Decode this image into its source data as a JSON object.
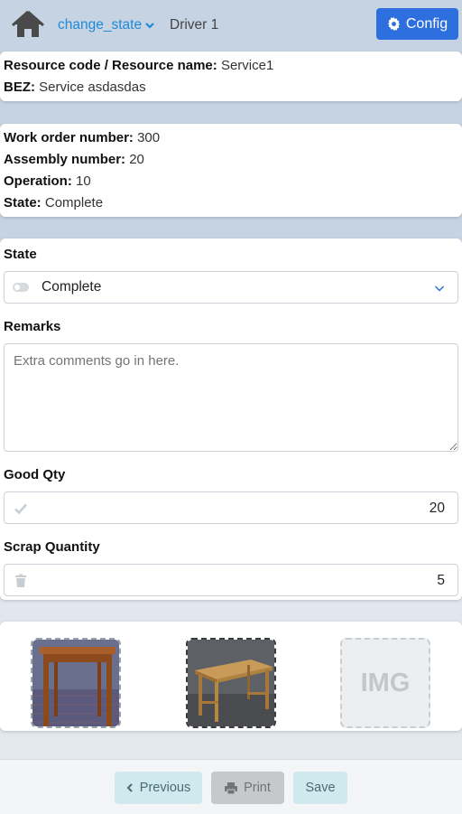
{
  "header": {
    "state_link": "change_state",
    "driver": "Driver 1",
    "config_label": "Config"
  },
  "resource": {
    "code_label": "Resource code / Resource name:",
    "code_value": "Service1",
    "bez_label": "BEZ:",
    "bez_value": "Service asdasdas"
  },
  "order": {
    "work_order_label": "Work order number:",
    "work_order_value": "300",
    "assembly_label": "Assembly number:",
    "assembly_value": "20",
    "operation_label": "Operation:",
    "operation_value": "10",
    "state_label": "State:",
    "state_value": "Complete"
  },
  "form": {
    "state_label": "State",
    "state_selected": "Complete",
    "remarks_label": "Remarks",
    "remarks_placeholder": "Extra comments go in here.",
    "good_qty_label": "Good Qty",
    "good_qty_value": "20",
    "scrap_label": "Scrap Quantity",
    "scrap_value": "5"
  },
  "images": {
    "placeholder_text": "IMG"
  },
  "footer": {
    "previous_label": "Previous",
    "print_label": "Print",
    "save_label": "Save"
  },
  "colors": {
    "accent": "#2e6fe0",
    "link": "#1f8ad6"
  },
  "icons": [
    "home-icon",
    "chevron-down-icon",
    "gear-icon",
    "toggle-icon",
    "check-icon",
    "trash-icon",
    "chevron-left-icon",
    "print-icon"
  ]
}
